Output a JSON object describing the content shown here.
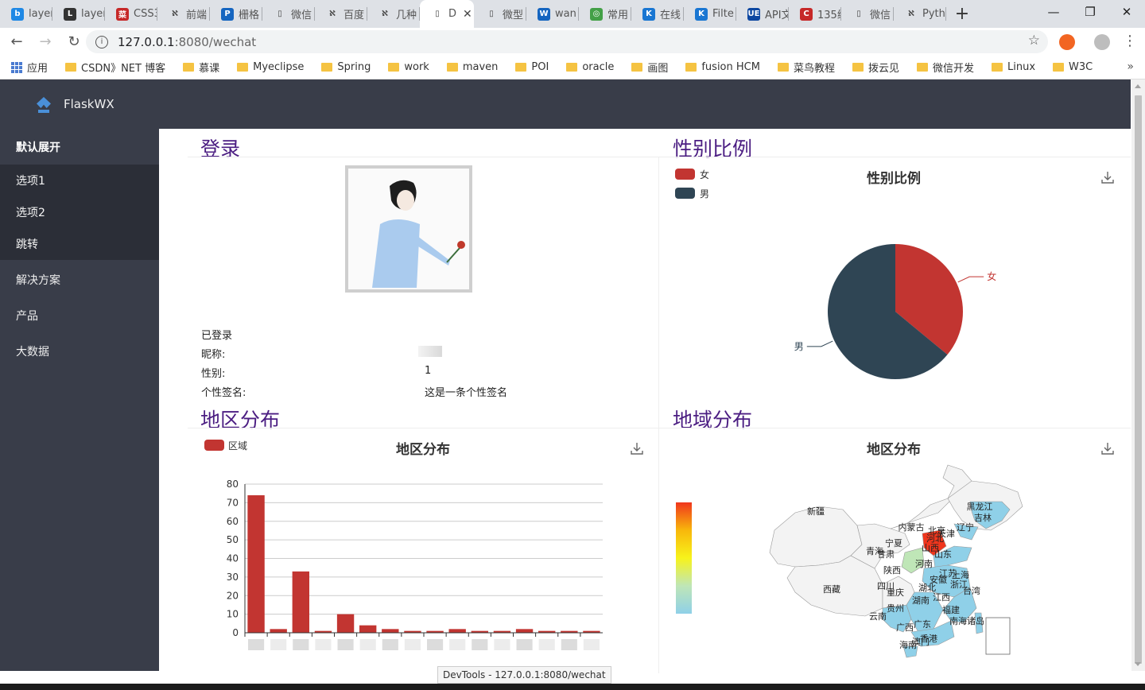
{
  "browser": {
    "tabs": [
      {
        "label": "layer",
        "fav_color": "#1e88e5",
        "fav_char": "b"
      },
      {
        "label": "layer",
        "fav_color": "#333333",
        "fav_char": "L"
      },
      {
        "label": "CSS3",
        "fav_color": "#c62828",
        "fav_char": "菜"
      },
      {
        "label": "前端",
        "fav_color": "#dee1e6",
        "fav_char": "ℵ"
      },
      {
        "label": "栅格",
        "fav_color": "#1565c0",
        "fav_char": "P"
      },
      {
        "label": "微信",
        "fav_color": "#dee1e6",
        "fav_char": "▯"
      },
      {
        "label": "百度",
        "fav_color": "#dee1e6",
        "fav_char": "ℵ"
      },
      {
        "label": "几种",
        "fav_color": "#dee1e6",
        "fav_char": "ℵ"
      },
      {
        "label": "D",
        "fav_color": "#ffffff",
        "fav_char": "▯",
        "active": true
      },
      {
        "label": "微型",
        "fav_color": "#dee1e6",
        "fav_char": "▯"
      },
      {
        "label": "wan",
        "fav_color": "#1565c0",
        "fav_char": "W"
      },
      {
        "label": "常用",
        "fav_color": "#43a047",
        "fav_char": "◎"
      },
      {
        "label": "在线",
        "fav_color": "#1976d2",
        "fav_char": "K"
      },
      {
        "label": "Filte",
        "fav_color": "#1976d2",
        "fav_char": "K"
      },
      {
        "label": "API文",
        "fav_color": "#0d47a1",
        "fav_char": "UE"
      },
      {
        "label": "135编",
        "fav_color": "#c62828",
        "fav_char": "C"
      },
      {
        "label": "微信",
        "fav_color": "#dee1e6",
        "fav_char": "▯"
      },
      {
        "label": "Pyth",
        "fav_color": "#dee1e6",
        "fav_char": "ℵ"
      }
    ],
    "new_tab": "+",
    "url_host": "127.0.0.1",
    "url_path": ":8080/wechat",
    "bookmarks": [
      "应用",
      "CSDN》NET 博客",
      "慕课",
      "Myeclipse",
      "Spring",
      "work",
      "maven",
      "POI",
      "oracle",
      "画图",
      "fusion HCM",
      "菜鸟教程",
      "拨云见",
      "微信开发",
      "Linux",
      "W3C"
    ],
    "status_tooltip": "DevTools - 127.0.0.1:8080/wechat"
  },
  "app": {
    "brand": "FlaskWX",
    "sidebar": {
      "group_label": "默认展开",
      "sub_items": [
        "选项1",
        "选项2",
        "跳转"
      ],
      "items": [
        "解决方案",
        "产品",
        "大数据"
      ]
    },
    "login": {
      "title": "登录",
      "status": "已登录",
      "nickname_label": "昵称:",
      "gender_label": "性别:",
      "gender_value": "1",
      "signature_label": "个性签名:",
      "signature_value": "这是一条个性签名"
    },
    "gender_panel_title": "性别比例",
    "region_panel_title": "地区分布",
    "geo_panel_title": "地域分布"
  },
  "chart_data": [
    {
      "type": "pie",
      "title": "性别比例",
      "legend": [
        "女",
        "男"
      ],
      "labels": [
        "女",
        "男"
      ],
      "values": [
        36,
        64
      ],
      "colors": [
        "#c23531",
        "#2f4554"
      ],
      "legend_position": "top-left"
    },
    {
      "type": "bar",
      "title": "地区分布",
      "legend": [
        "区域"
      ],
      "series": [
        {
          "name": "区域",
          "values": [
            74,
            2,
            33,
            1,
            10,
            4,
            2,
            1,
            1,
            2,
            1,
            1,
            2,
            1,
            1,
            1
          ]
        }
      ],
      "ylim": [
        0,
        80
      ],
      "yticks": [
        0,
        10,
        20,
        30,
        40,
        50,
        60,
        70,
        80
      ],
      "color": "#c23531",
      "grid": true,
      "legend_position": "top-left"
    },
    {
      "type": "map",
      "title": "地区分布",
      "region_labels": [
        "新疆",
        "西藏",
        "青海",
        "甘肃",
        "内蒙古",
        "宁夏",
        "陕西",
        "四川",
        "重庆",
        "云南",
        "贵州",
        "广西",
        "广东",
        "海南",
        "湖南",
        "湖北",
        "河南",
        "山西",
        "河北",
        "北京",
        "天津",
        "山东",
        "江苏",
        "安徽",
        "浙江",
        "江西",
        "福建",
        "台湾",
        "上海",
        "辽宁",
        "吉林",
        "黑龙江",
        "香港",
        "澳门",
        "南海诸岛"
      ],
      "visual_map": [
        "#f0361d",
        "#f8b70b",
        "#f7f31b",
        "#bfe6b7",
        "#8fd0e8"
      ]
    }
  ]
}
